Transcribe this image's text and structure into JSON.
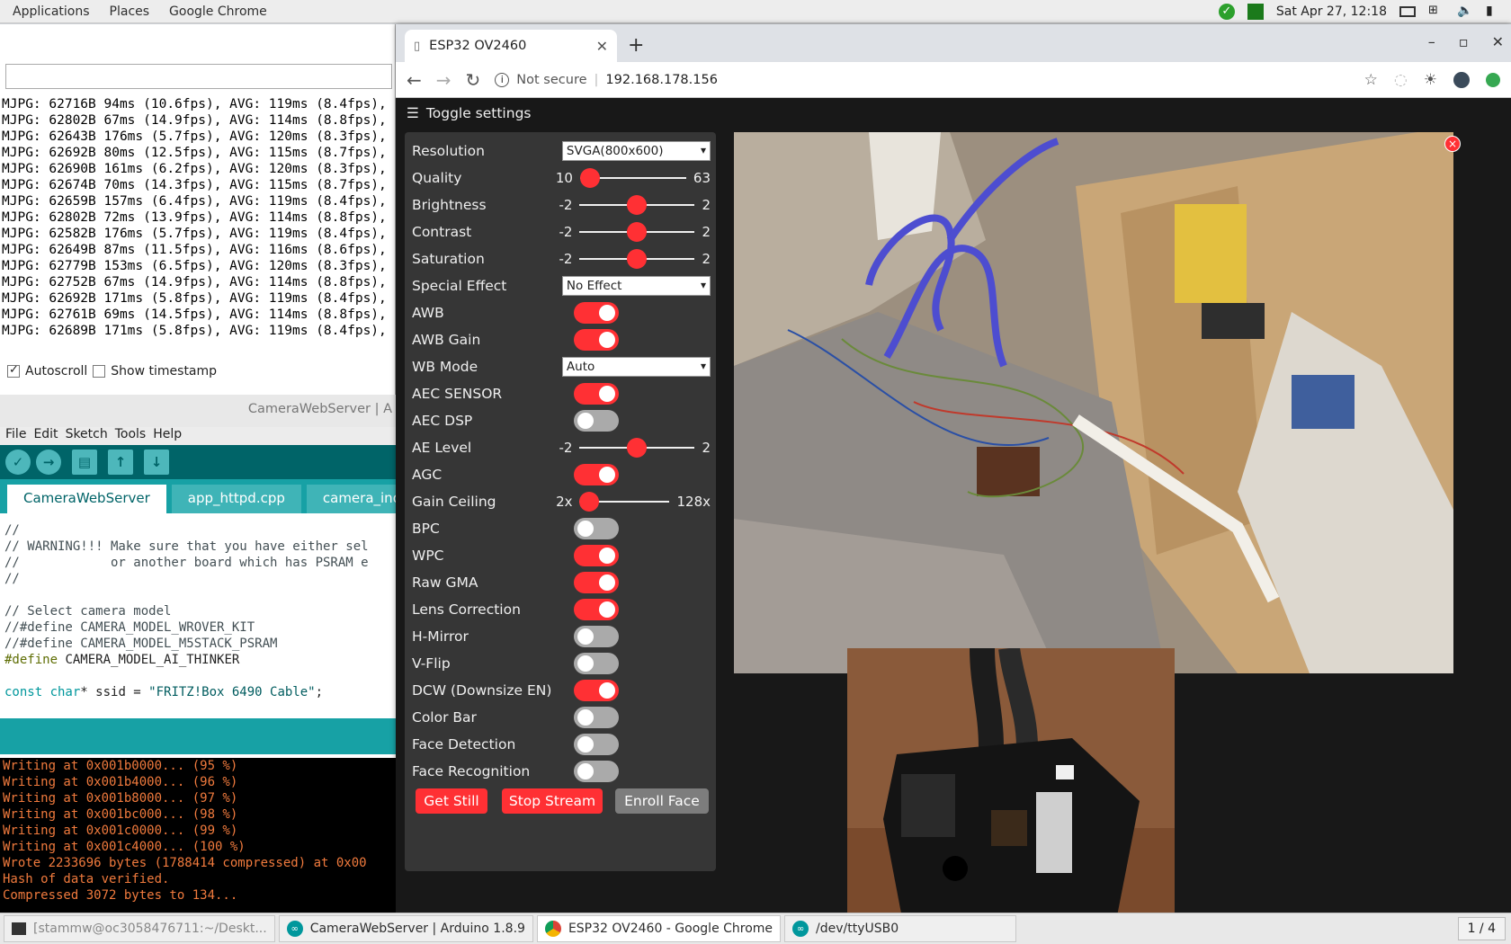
{
  "topbar": {
    "menus": [
      "Applications",
      "Places",
      "Google Chrome"
    ],
    "datetime": "Sat Apr 27, 12:18"
  },
  "serial_monitor": {
    "lines": [
      "MJPG: 62716B 94ms (10.6fps), AVG: 119ms (8.4fps),",
      "MJPG: 62802B 67ms (14.9fps), AVG: 114ms (8.8fps),",
      "MJPG: 62643B 176ms (5.7fps), AVG: 120ms (8.3fps),",
      "MJPG: 62692B 80ms (12.5fps), AVG: 115ms (8.7fps),",
      "MJPG: 62690B 161ms (6.2fps), AVG: 120ms (8.3fps),",
      "MJPG: 62674B 70ms (14.3fps), AVG: 115ms (8.7fps),",
      "MJPG: 62659B 157ms (6.4fps), AVG: 119ms (8.4fps),",
      "MJPG: 62802B 72ms (13.9fps), AVG: 114ms (8.8fps),",
      "MJPG: 62582B 176ms (5.7fps), AVG: 119ms (8.4fps),",
      "MJPG: 62649B 87ms (11.5fps), AVG: 116ms (8.6fps),",
      "MJPG: 62779B 153ms (6.5fps), AVG: 120ms (8.3fps),",
      "MJPG: 62752B 67ms (14.9fps), AVG: 114ms (8.8fps),",
      "MJPG: 62692B 171ms (5.8fps), AVG: 119ms (8.4fps),",
      "MJPG: 62761B 69ms (14.5fps), AVG: 114ms (8.8fps),",
      "MJPG: 62689B 171ms (5.8fps), AVG: 119ms (8.4fps),"
    ],
    "autoscroll_label": "Autoscroll",
    "timestamp_label": "Show timestamp"
  },
  "arduino": {
    "title": "CameraWebServer | A",
    "menu": [
      "File",
      "Edit",
      "Sketch",
      "Tools",
      "Help"
    ],
    "tabs": [
      "CameraWebServer",
      "app_httpd.cpp",
      "camera_inde"
    ],
    "code": {
      "l1": "//",
      "l2": "// WARNING!!! Make sure that you have either sel",
      "l3": "//            or another board which has PSRAM e",
      "l4": "//",
      "l5": "",
      "l6": "// Select camera model",
      "l7": "//#define CAMERA_MODEL_WROVER_KIT",
      "l8": "//#define CAMERA_MODEL_M5STACK_PSRAM",
      "l9_kw": "#define",
      "l9_rest": " CAMERA_MODEL_AI_THINKER",
      "l10_kw": "const char",
      "l10_mid": "* ssid = ",
      "l10_str": "\"FRITZ!Box 6490 Cable\"",
      "l10_end": ";"
    },
    "console": [
      "Writing at 0x001b0000... (95 %)",
      "Writing at 0x001b4000... (96 %)",
      "Writing at 0x001b8000... (97 %)",
      "Writing at 0x001bc000... (98 %)",
      "Writing at 0x001c0000... (99 %)",
      "Writing at 0x001c4000... (100 %)",
      "Wrote 2233696 bytes (1788414 compressed) at 0x00",
      "Hash of data verified.",
      "Compressed 3072 bytes to 134..."
    ]
  },
  "chrome": {
    "tab_title": "ESP32 OV2460",
    "security": "Not secure",
    "url": "192.168.178.156"
  },
  "page": {
    "toggle_label": "Toggle settings",
    "settings": {
      "resolution": {
        "label": "Resolution",
        "value": "SVGA(800x600)"
      },
      "quality": {
        "label": "Quality",
        "min": "10",
        "max": "63",
        "value": 10
      },
      "brightness": {
        "label": "Brightness",
        "min": "-2",
        "max": "2",
        "value": 0
      },
      "contrast": {
        "label": "Contrast",
        "min": "-2",
        "max": "2",
        "value": 0
      },
      "saturation": {
        "label": "Saturation",
        "min": "-2",
        "max": "2",
        "value": 0
      },
      "special_effect": {
        "label": "Special Effect",
        "value": "No Effect"
      },
      "awb": {
        "label": "AWB",
        "on": true
      },
      "awb_gain": {
        "label": "AWB Gain",
        "on": true
      },
      "wb_mode": {
        "label": "WB Mode",
        "value": "Auto"
      },
      "aec_sensor": {
        "label": "AEC SENSOR",
        "on": true
      },
      "aec_dsp": {
        "label": "AEC DSP",
        "on": false
      },
      "ae_level": {
        "label": "AE Level",
        "min": "-2",
        "max": "2",
        "value": 0
      },
      "agc": {
        "label": "AGC",
        "on": true
      },
      "gain_ceiling": {
        "label": "Gain Ceiling",
        "min": "2x",
        "max": "128x",
        "value": 0
      },
      "bpc": {
        "label": "BPC",
        "on": false
      },
      "wpc": {
        "label": "WPC",
        "on": true
      },
      "raw_gma": {
        "label": "Raw GMA",
        "on": true
      },
      "lens_correction": {
        "label": "Lens Correction",
        "on": true
      },
      "h_mirror": {
        "label": "H-Mirror",
        "on": false
      },
      "v_flip": {
        "label": "V-Flip",
        "on": false
      },
      "dcw": {
        "label": "DCW (Downsize EN)",
        "on": true
      },
      "color_bar": {
        "label": "Color Bar",
        "on": false
      },
      "face_detection": {
        "label": "Face Detection",
        "on": false
      },
      "face_recognition": {
        "label": "Face Recognition",
        "on": false
      }
    },
    "buttons": {
      "get_still": "Get Still",
      "stop_stream": "Stop Stream",
      "enroll_face": "Enroll Face"
    },
    "close_glyph": "×"
  },
  "taskbar": {
    "items": [
      "[stammw@oc3058476711:~/Deskt...",
      "CameraWebServer | Arduino 1.8.9",
      "ESP32 OV2460 - Google Chrome",
      "/dev/ttyUSB0"
    ],
    "pager": "1 / 4"
  }
}
